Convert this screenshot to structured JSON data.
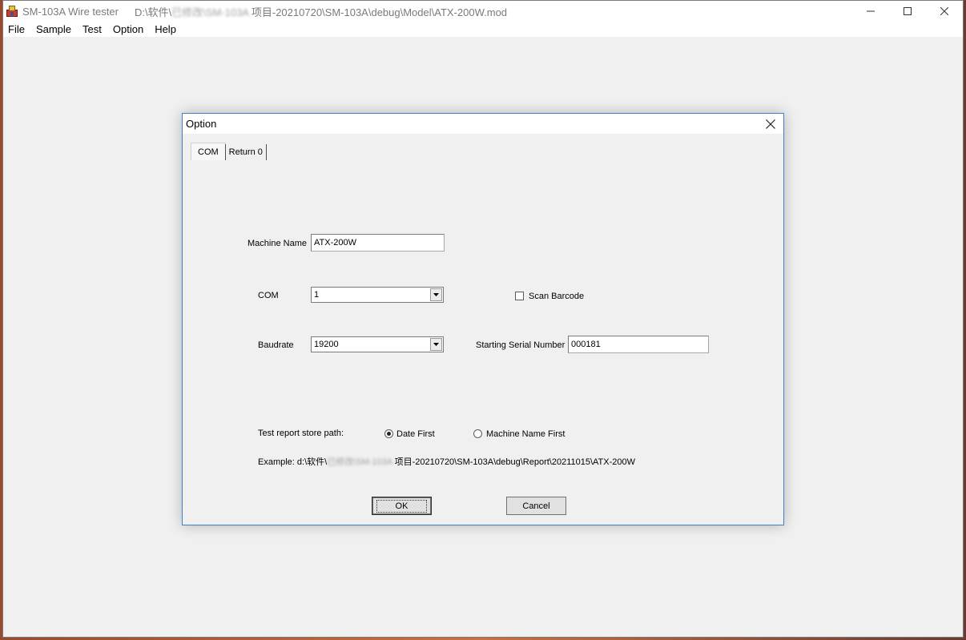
{
  "window": {
    "app_title": "SM-103A Wire tester",
    "path_prefix": "D:\\软件\\",
    "path_blurred": "已修改\\SM-103A",
    "path_suffix": " 项目-20210720\\SM-103A\\debug\\Model\\ATX-200W.mod"
  },
  "menu": [
    "File",
    "Sample",
    "Test",
    "Option",
    "Help"
  ],
  "dialog": {
    "title": "Option",
    "tabs": [
      {
        "label": "COM",
        "active": true
      },
      {
        "label": "Return 0",
        "active": false
      }
    ],
    "machine_name_label": "Machine Name",
    "machine_name_value": "ATX-200W",
    "com_label": "COM",
    "com_value": "1",
    "scan_barcode_label": "Scan Barcode",
    "scan_barcode_checked": false,
    "baudrate_label": "Baudrate",
    "baudrate_value": "19200",
    "serial_label": "Starting Serial Number",
    "serial_value": "000181",
    "store_path_label": "Test report store path:",
    "radio_date_first": "Date First",
    "radio_machine_first": "Machine Name First",
    "selected_option": "Date First",
    "example_prefix": "Example: d:\\软件\\",
    "example_blurred": "已修改\\SM-103A",
    "example_suffix": " 项目-20210720\\SM-103A\\debug\\Report\\20211015\\ATX-200W",
    "ok_label": "OK",
    "cancel_label": "Cancel"
  },
  "icons": {
    "app": "app-icon",
    "minimize": "minimize-icon",
    "maximize": "maximize-icon",
    "close": "close-icon",
    "dropdown": "chevron-down-icon"
  }
}
